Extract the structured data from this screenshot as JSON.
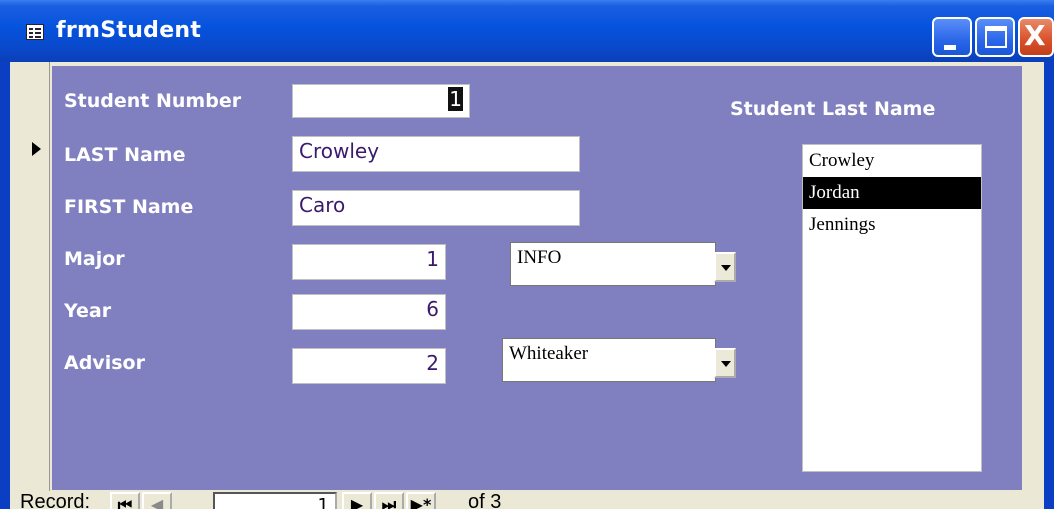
{
  "window": {
    "title": "frmStudent",
    "icon": "form-icon",
    "controls": {
      "minimize": "minimize-icon",
      "maximize": "maximize-icon",
      "close": "close-icon",
      "close_glyph": "X"
    }
  },
  "form": {
    "fields": {
      "student_number": {
        "label": "Student Number",
        "value": "1"
      },
      "last_name": {
        "label": "LAST Name",
        "value": "Crowley"
      },
      "first_name": {
        "label": "FIRST Name",
        "value": "Caro"
      },
      "major": {
        "label": "Major",
        "value": "1",
        "combo_value": "INFO"
      },
      "year": {
        "label": "Year",
        "value": "6"
      },
      "advisor": {
        "label": "Advisor",
        "value": "2",
        "combo_value": "Whiteaker"
      }
    },
    "list": {
      "header": "Student Last Name",
      "items": [
        "Crowley",
        "Jordan",
        "Jennings"
      ],
      "selected_index": 1
    }
  },
  "navigation": {
    "label": "Record:",
    "current_record": "1",
    "of_text": "of  3",
    "buttons": {
      "first": "⏮",
      "prev": "◀",
      "next": "▶",
      "last": "⏭",
      "new": "▶*"
    }
  },
  "colors": {
    "detail_background": "#8080c0",
    "label_text": "#ffffff",
    "field_text": "#3b1a6e",
    "selected_item_bg": "#000000"
  }
}
